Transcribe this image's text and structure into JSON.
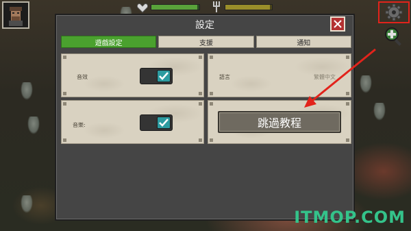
{
  "dialog": {
    "title": "設定",
    "tabs": [
      {
        "label": "遊戲設定",
        "active": true
      },
      {
        "label": "支援",
        "active": false
      },
      {
        "label": "通知",
        "active": false
      }
    ],
    "settings": {
      "sound_effects": {
        "label": "音效",
        "enabled": true
      },
      "music": {
        "label": "音樂:",
        "enabled": true
      },
      "language": {
        "label": "語言",
        "value": "繁體中文"
      },
      "skip_tutorial_label": "跳過教程"
    }
  },
  "watermark": "ITMOP.COM",
  "colors": {
    "accent_green": "#4aa12e",
    "toggle_teal": "#2d9ba0",
    "close_red": "#b43232",
    "highlight_red": "#e2231b",
    "watermark_green": "#34c38a"
  },
  "hud": {
    "health_fraction": 0.95,
    "hunger_fraction": 0.95,
    "icons": [
      "portrait",
      "heart-icon",
      "fork-icon",
      "gear-icon",
      "zoom-in-icon"
    ]
  }
}
